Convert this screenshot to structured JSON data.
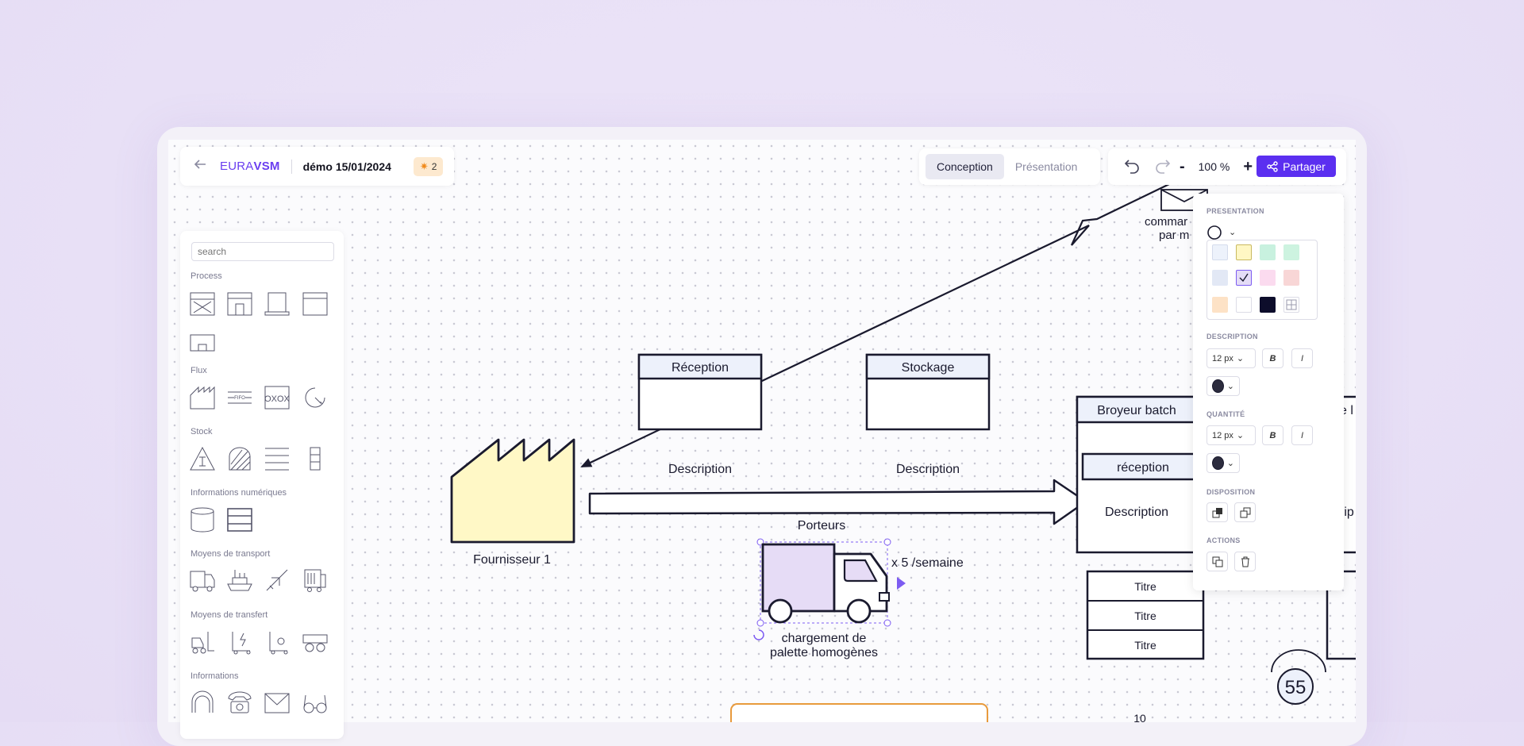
{
  "header": {
    "logo_prefix": "EURA",
    "logo_suffix": "VSM",
    "doc_title": "démo 15/01/2024",
    "badge_count": "2",
    "modes": [
      "Conception",
      "Présentation"
    ],
    "active_mode": "Conception",
    "zoom": "100 %",
    "zoom_minus": "-",
    "zoom_plus": "+",
    "share_label": "Partager"
  },
  "palette": {
    "search_placeholder": "search",
    "sections": {
      "process": "Process",
      "flux": "Flux",
      "stock": "Stock",
      "info_num": "Informations numériques",
      "transport": "Moyens de transport",
      "transfert": "Moyens de transfert",
      "informations": "Informations"
    },
    "flux_text": "OXOX",
    "flux_small": "FIFO"
  },
  "diagram": {
    "reception_title": "Réception",
    "reception_desc": "Description",
    "stockage_title": "Stockage",
    "stockage_desc": "Description",
    "supplier_label": "Fournisseur 1",
    "porteurs_label": "Porteurs",
    "frequency_label": "x 5 /semaine",
    "truck_caption_1": "chargement de",
    "truck_caption_2": "palette homogènes",
    "broyeur_title": "Broyeur batch",
    "reception2_title": "réception",
    "broyeur_desc": "Description",
    "partial_title": "e l",
    "partial_desc": "rip",
    "titre_rows": [
      "Titre",
      "Titre",
      "Titre"
    ],
    "mail_label_1": "commar",
    "mail_label_2": "par m",
    "counter": "55",
    "bottom_number": "10"
  },
  "properties": {
    "presentation": "PRESENTATION",
    "description": "DESCRIPTION",
    "quantite": "QUANTITÉ",
    "disposition": "DISPOSITION",
    "actions": "ACTIONS",
    "desc_size": "12 px",
    "qty_size": "12 px",
    "bold": "B",
    "italic": "I",
    "colors": [
      "#edf2fb",
      "#fff7c4",
      "#c8f1df",
      "#cdf3e0",
      "#e2e8f5",
      "#e4dcf6",
      "#fbdbef",
      "#f8d6d6",
      "#fde2c6",
      "#ffffff",
      "#0d0d2b",
      "grid"
    ]
  }
}
